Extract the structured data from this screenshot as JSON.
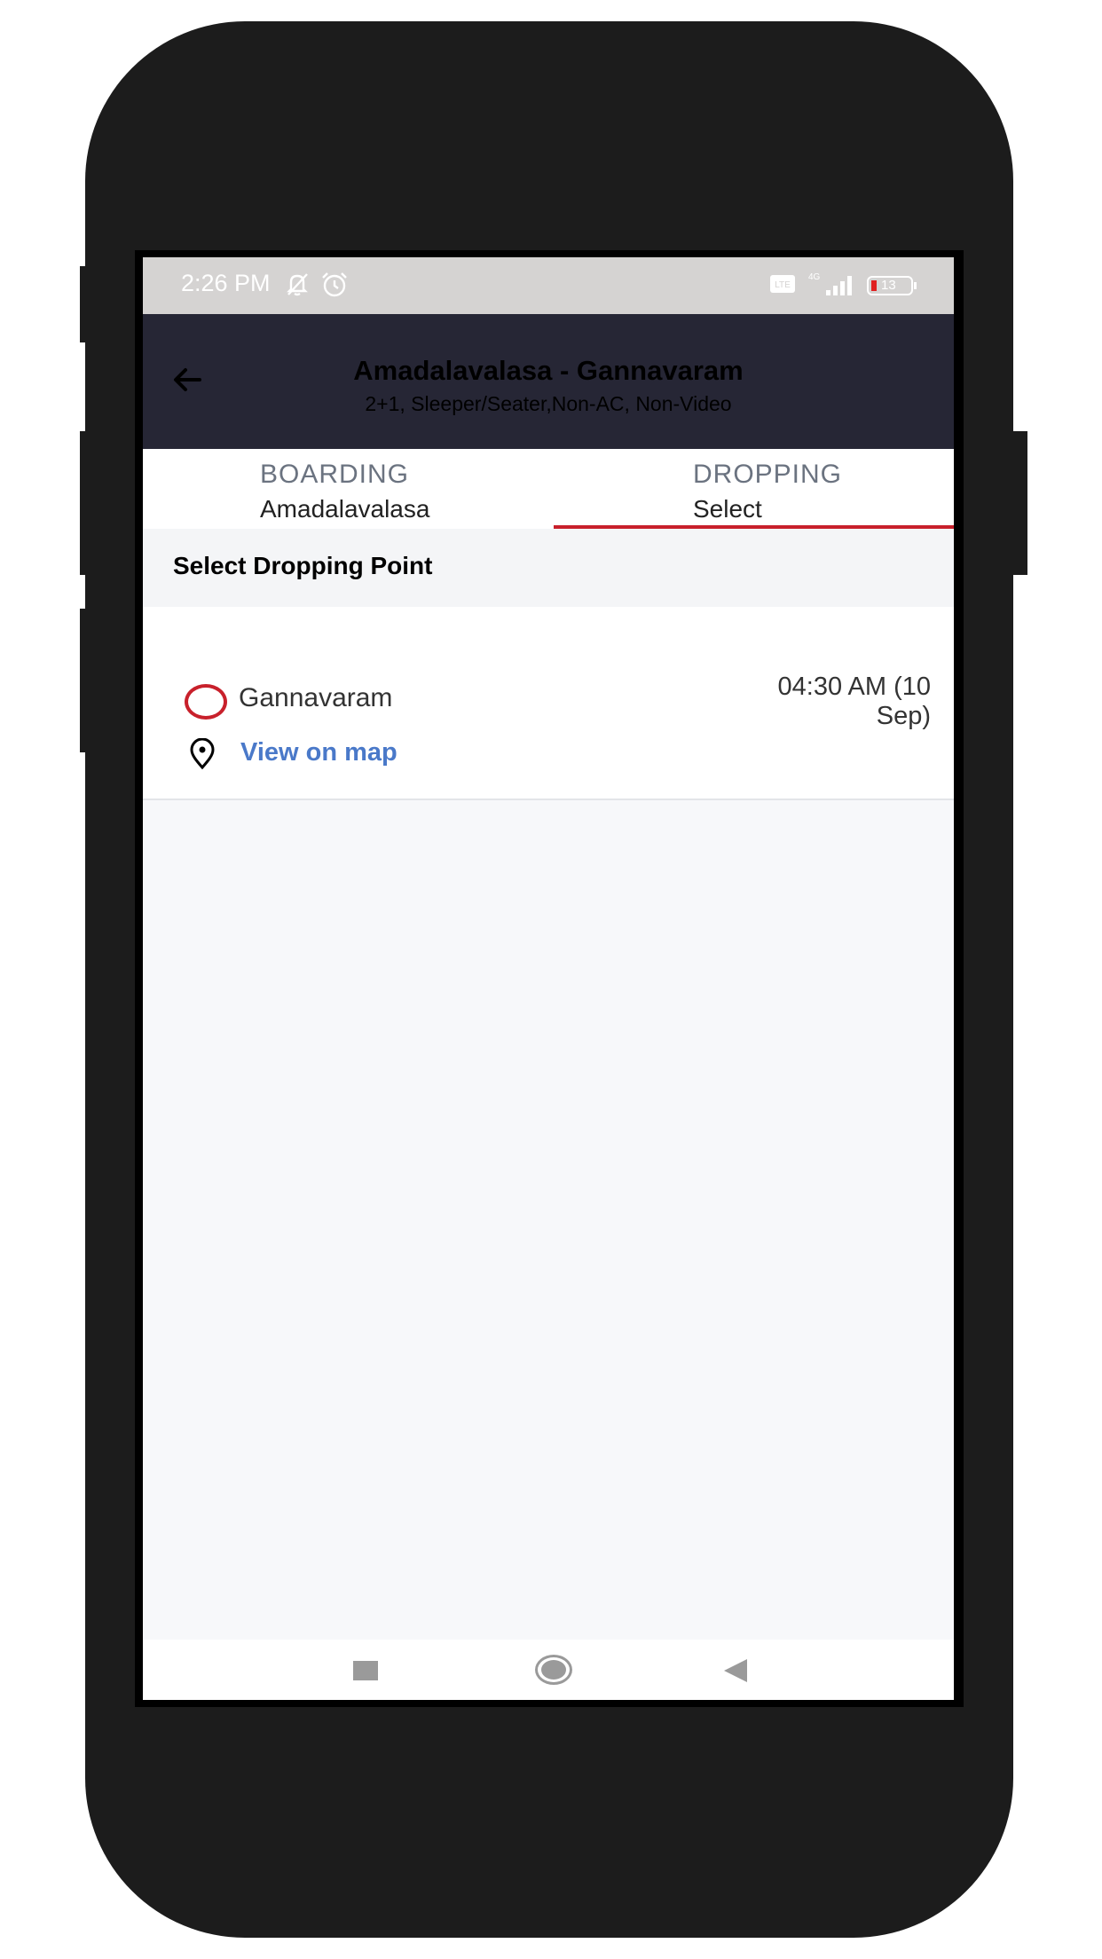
{
  "status_bar": {
    "time": "2:26 PM",
    "battery": "13",
    "icons": [
      "mute-bell-icon",
      "alarm-icon",
      "volte-icon",
      "4g-signal-icon",
      "battery-icon"
    ]
  },
  "header": {
    "title": "Amadalavalasa - Gannavaram",
    "subtitle": "2+1, Sleeper/Seater,Non-AC, Non-Video",
    "back_icon": "arrow-left-icon"
  },
  "tabs": [
    {
      "label": "BOARDING",
      "value": "Amadalavalasa",
      "active": false
    },
    {
      "label": "DROPPING",
      "value": "Select",
      "active": true
    }
  ],
  "section": {
    "title": "Select Dropping Point"
  },
  "dropping_points": [
    {
      "name": "Gannavaram",
      "time_line1": "04:30 AM (10",
      "time_line2": "Sep)",
      "map_link": "View on map"
    }
  ],
  "colors": {
    "accent": "#c8202b",
    "header_bg": "#262635",
    "link": "#4a79c9",
    "status_bar": "#d5d3d2"
  }
}
